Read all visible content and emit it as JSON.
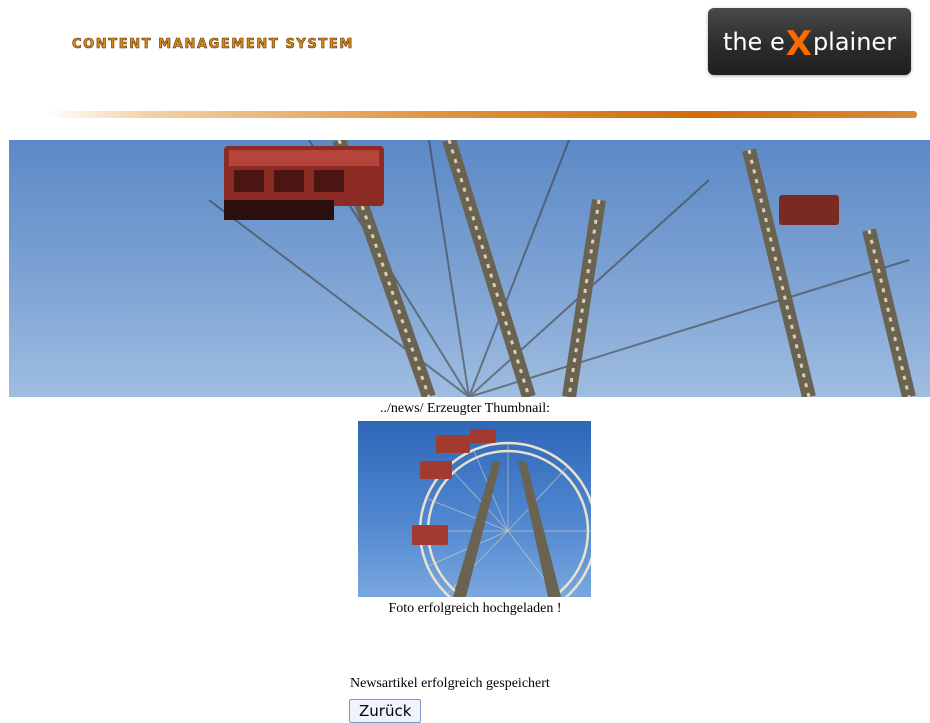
{
  "header": {
    "title": "CONTENT MANAGEMENT SYSTEM",
    "logo": {
      "before": "the e",
      "x": "X",
      "after": "plainer"
    }
  },
  "upload": {
    "thumbnail_caption": "../news/ Erzeugter Thumbnail:",
    "upload_success": "Foto erfolgreich hochgeladen !"
  },
  "result": {
    "saved_message": "Newsartikel erfolgreich gespeichert",
    "back_label": "Zurück"
  },
  "colors": {
    "accent": "#d98a1a",
    "rule": "#cf6c0d",
    "logo_bg": "#2c2c2c",
    "logo_x": "#ff6a00",
    "sky": "#6f98cf"
  }
}
